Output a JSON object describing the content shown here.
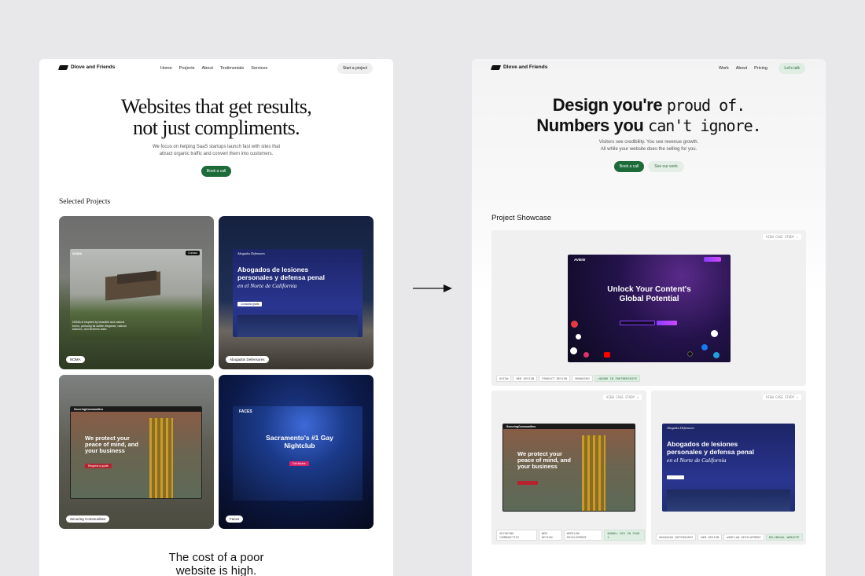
{
  "left": {
    "brand": "Dlove and Friends",
    "nav": [
      "Home",
      "Projects",
      "About",
      "Testimonials",
      "Services"
    ],
    "cta": "Start a project",
    "hero_line1": "Websites that get results,",
    "hero_line2": "not just compliments.",
    "sub_line1": "We focus on helping SaaS startups launch fast with sites that",
    "sub_line2": "attract organic traffic and convert them into customers.",
    "book": "Book a call",
    "section": "Selected Projects",
    "tiles": {
      "noma": {
        "tag": "NOMA",
        "brand": "NOMA",
        "menu_btn": "Contact",
        "copy": "NOMA is inspired by beautiful and natural forms, pursuing its subtle elegance, natural balance, and timeless taste."
      },
      "abogados": {
        "tag": "Abogados Defensores",
        "brand": "Abogados Defensores",
        "title": "Abogados de lesiones personales y defensa penal",
        "title_italic": "en el Norte de California",
        "btn": "Consulta gratis"
      },
      "securing": {
        "tag": "Securing Communities",
        "brand": "SecuringCommunities",
        "title": "We protect your peace of mind, and your business",
        "btn": "Request a quote"
      },
      "faces": {
        "tag": "Faces",
        "brand": "FACES",
        "title": "Sacramento's #1 Gay Nightclub",
        "btn": "Get tickets"
      }
    },
    "bottom_line1": "The cost of a poor",
    "bottom_line2": "website is high."
  },
  "right": {
    "brand": "Dlove and Friends",
    "nav": [
      "Work",
      "About",
      "Pricing"
    ],
    "cta": "Let's talk",
    "hero1_bold": "Design you're",
    "hero1_mono": "proud of.",
    "hero2_bold": "Numbers you",
    "hero2_mono": "can't ignore.",
    "sub_line1": "Visitors see credibility. You see revenue growth.",
    "sub_line2": "All while your website does the selling for you.",
    "book": "Book a call",
    "see": "See our work",
    "section": "Project Showcase",
    "featured": {
      "case": "VIEW CASE STUDY ↗",
      "brand": "AVIEW",
      "headline1": "Unlock Your Content's",
      "headline2": "Global Potential",
      "chips": [
        "AVIEW",
        "WEB DESIGN",
        "PRODUCT DESIGN",
        "BRANDING"
      ],
      "highlight": "+$600K IN PARTNERSHIPS"
    },
    "card_left": {
      "case": "VIEW CASE STUDY ↗",
      "brand": "SecuringCommunities",
      "title": "We protect your peace of mind, and your business",
      "chips": [
        "SECURING COMMUNITIES",
        "WEB DESIGN",
        "WEBFLOW DEVELOPMENT"
      ],
      "highlight": "$800K+ REV IN YEAR 1"
    },
    "card_right": {
      "case": "VIEW CASE STUDY ↗",
      "brand": "Abogados Defensores",
      "title": "Abogados de lesiones personales y defensa penal",
      "title_italic": "en el Norte de California",
      "chips": [
        "ABOGADOS DEFENSORES",
        "WEB DESIGN",
        "WEBFLOW DEVELOPMENT"
      ],
      "highlight": "BILINGUAL WEBSITE"
    }
  },
  "icons": [
    "arrow-right-icon",
    "logo-mark-icon"
  ],
  "colors": {
    "accent_green": "#1e6b3a",
    "background": "#e8e7e9"
  }
}
